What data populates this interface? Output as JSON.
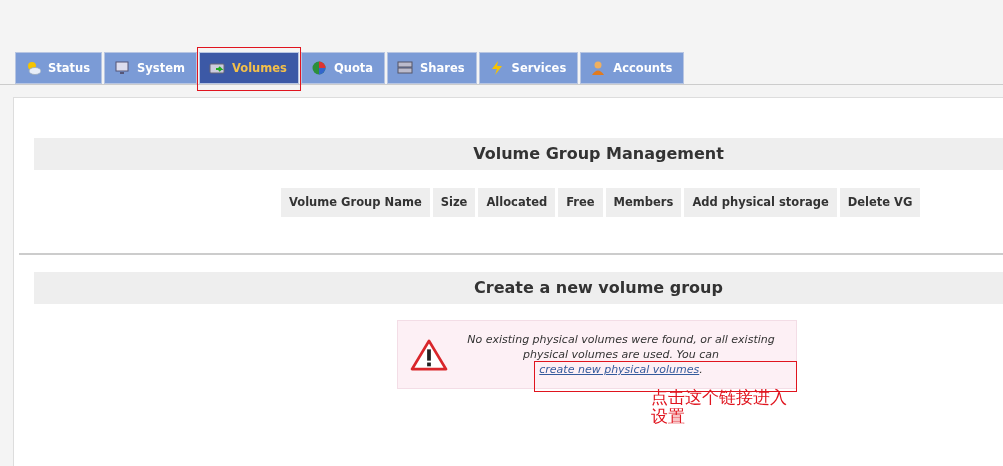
{
  "tabs": [
    {
      "label": "Status",
      "selected": false,
      "highlighted": false
    },
    {
      "label": "System",
      "selected": false,
      "highlighted": false
    },
    {
      "label": "Volumes",
      "selected": true,
      "highlighted": true
    },
    {
      "label": "Quota",
      "selected": false,
      "highlighted": false
    },
    {
      "label": "Shares",
      "selected": false,
      "highlighted": false
    },
    {
      "label": "Services",
      "selected": false,
      "highlighted": false
    },
    {
      "label": "Accounts",
      "selected": false,
      "highlighted": false
    }
  ],
  "volume_groups": {
    "heading": "Volume Group Management",
    "columns": [
      "Volume Group Name",
      "Size",
      "Allocated",
      "Free",
      "Members",
      "Add physical storage",
      "Delete VG"
    ]
  },
  "create_group": {
    "heading": "Create a new volume group",
    "alert": {
      "message": "No existing physical volumes were found, or all existing physical volumes are used. You can ",
      "link": "create new physical volumes",
      "after": ".",
      "highlighted": true
    }
  },
  "annotation_note": "点击这个链接进入设置"
}
